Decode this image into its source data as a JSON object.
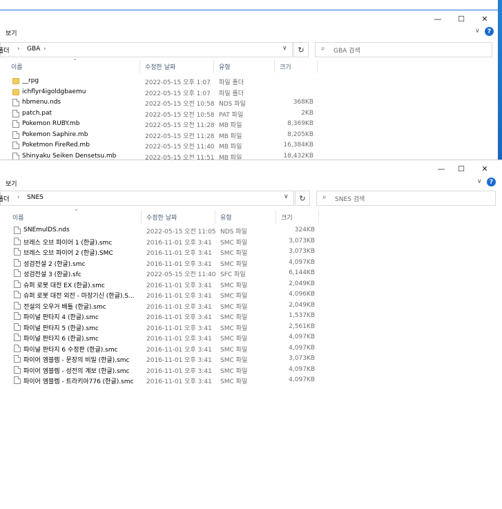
{
  "gba": {
    "title_buttons": {
      "minimize": "—",
      "maximize": "☐",
      "close": "✕"
    },
    "ribbon_label": "보기",
    "breadcrumb": [
      "폴더",
      "GBA"
    ],
    "search_placeholder": "GBA 검색",
    "headers": {
      "name": "이름",
      "date": "수정한 날짜",
      "type": "유형",
      "size": "크기"
    },
    "files": [
      {
        "icon": "folder",
        "name": "__rpg",
        "date": "2022-05-15 오후 1:07",
        "type": "파일 폴더",
        "size": ""
      },
      {
        "icon": "folder",
        "name": "ichflyr4igoldgbaemu",
        "date": "2022-05-15 오후 1:07",
        "type": "파일 폴더",
        "size": ""
      },
      {
        "icon": "file",
        "name": "hbmenu.nds",
        "date": "2022-05-15 오전 10:58",
        "type": "NDS 파일",
        "size": "368KB"
      },
      {
        "icon": "file",
        "name": "patch.pat",
        "date": "2022-05-15 오전 10:58",
        "type": "PAT 파일",
        "size": "2KB"
      },
      {
        "icon": "file",
        "name": "Pokemon RUBY.mb",
        "date": "2022-05-15 오전 11:28",
        "type": "MB 파일",
        "size": "8,369KB"
      },
      {
        "icon": "file",
        "name": "Pokemon Saphire.mb",
        "date": "2022-05-15 오전 11:28",
        "type": "MB 파일",
        "size": "8,205KB"
      },
      {
        "icon": "file",
        "name": "Poketmon FireRed.mb",
        "date": "2022-05-15 오전 11:40",
        "type": "MB 파일",
        "size": "16,384KB"
      },
      {
        "icon": "file",
        "name": "Shinyaku Seiken Densetsu.mb",
        "date": "2022-05-15 오전 11:51",
        "type": "MB 파일",
        "size": "18,432KB"
      }
    ]
  },
  "snes": {
    "title_buttons": {
      "minimize": "—",
      "maximize": "☐",
      "close": "✕"
    },
    "ribbon_label": "보기",
    "breadcrumb": [
      "폴더",
      "SNES"
    ],
    "search_placeholder": "SNES 검색",
    "headers": {
      "name": "이름",
      "date": "수정한 날짜",
      "type": "유형",
      "size": "크기"
    },
    "files": [
      {
        "name": "SNEmulDS.nds",
        "date": "2022-05-15 오전 11:05",
        "type": "NDS 파일",
        "size": "324KB"
      },
      {
        "name": "브레스 오브 파이어 1 (한글).smc",
        "date": "2016-11-01 오후 3:41",
        "type": "SMC 파일",
        "size": "3,073KB"
      },
      {
        "name": "브레스 오브 파이어 2 (한글).SMC",
        "date": "2016-11-01 오후 3:41",
        "type": "SMC 파일",
        "size": "3,073KB"
      },
      {
        "name": "성검전설 2 (한글).smc",
        "date": "2016-11-01 오후 3:41",
        "type": "SMC 파일",
        "size": "4,097KB"
      },
      {
        "name": "성검전설 3 (한글).sfc",
        "date": "2022-05-15 오전 11:40",
        "type": "SFC 파일",
        "size": "6,144KB"
      },
      {
        "name": "슈퍼 로봇 대전 EX (한글).smc",
        "date": "2016-11-01 오후 3:41",
        "type": "SMC 파일",
        "size": "2,049KB"
      },
      {
        "name": "슈퍼 로봇 대전 외전 - 마장기신 (한글).S...",
        "date": "2016-11-01 오후 3:41",
        "type": "SMC 파일",
        "size": "4,096KB"
      },
      {
        "name": "전설의 오우거 배틀 (한글).smc",
        "date": "2016-11-01 오후 3:41",
        "type": "SMC 파일",
        "size": "2,049KB"
      },
      {
        "name": "파이널 판타지 4 (한글).smc",
        "date": "2016-11-01 오후 3:41",
        "type": "SMC 파일",
        "size": "1,537KB"
      },
      {
        "name": "파이널 판타지 5 (한글).smc",
        "date": "2016-11-01 오후 3:41",
        "type": "SMC 파일",
        "size": "2,561KB"
      },
      {
        "name": "파이널 판타지 6 (한글).smc",
        "date": "2016-11-01 오후 3:41",
        "type": "SMC 파일",
        "size": "4,097KB"
      },
      {
        "name": "파이널 판타지 6 수정판 (한글).smc",
        "date": "2016-11-01 오후 3:41",
        "type": "SMC 파일",
        "size": "4,097KB"
      },
      {
        "name": "파이어 엠블렘 - 문장의 비밀 (한글).smc",
        "date": "2016-11-01 오후 3:41",
        "type": "SMC 파일",
        "size": "3,073KB"
      },
      {
        "name": "파이어 엠블렘 - 성전의 계보 (한글).smc",
        "date": "2016-11-01 오후 3:41",
        "type": "SMC 파일",
        "size": "4,097KB"
      },
      {
        "name": "파이어 엠블렘 - 트라키아776 (한글).smc",
        "date": "2016-11-01 오후 3:41",
        "type": "SMC 파일",
        "size": "4,097KB"
      }
    ]
  }
}
